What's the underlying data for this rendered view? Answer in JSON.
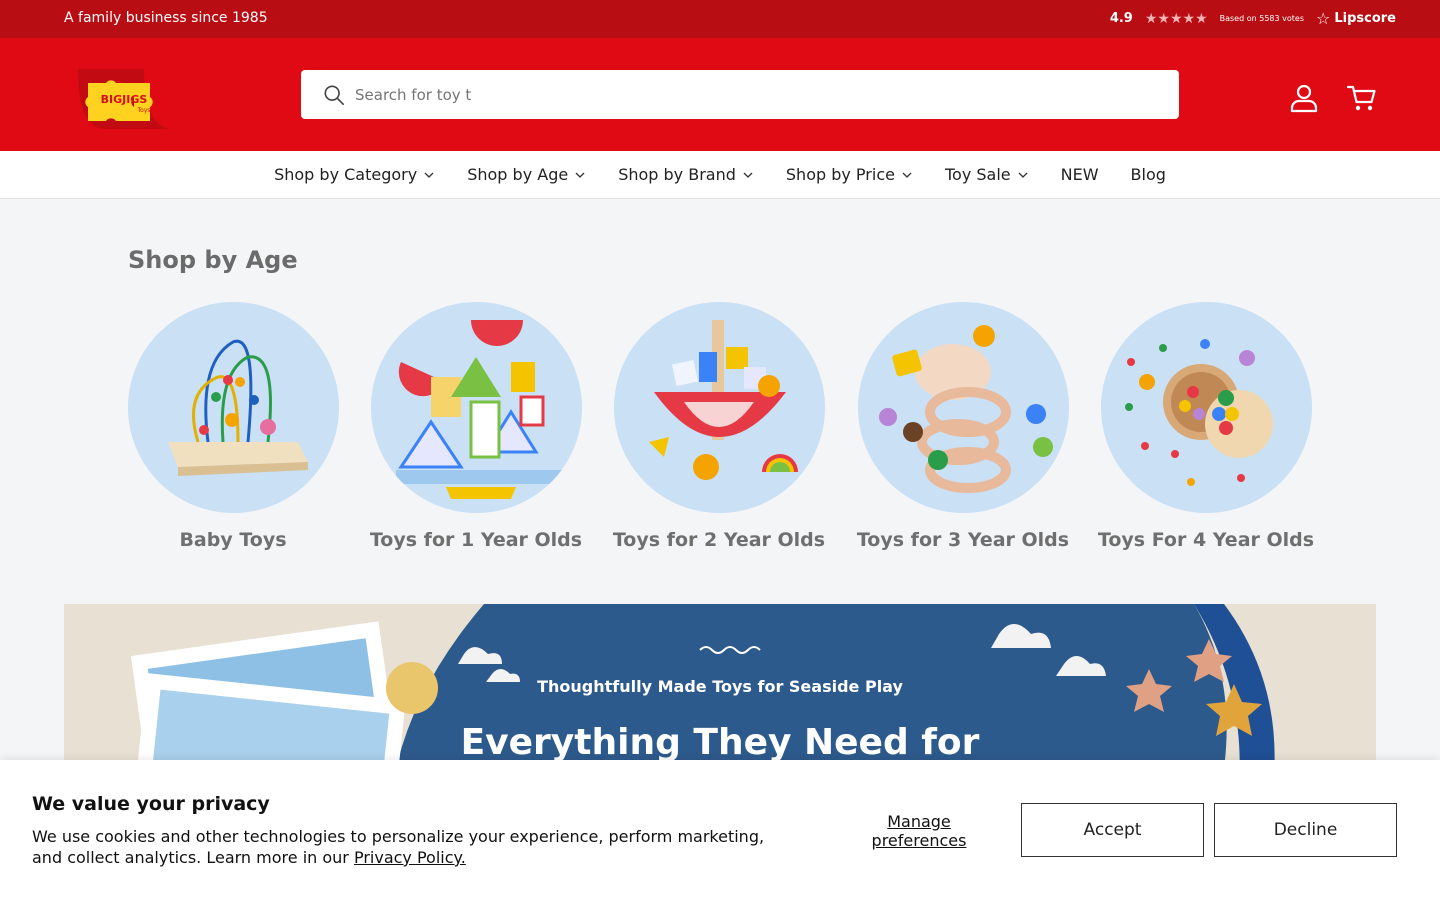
{
  "announcement": {
    "tagline": "A family business since 1985",
    "rating_score": "4.9",
    "rating_stars": "★★★★★",
    "rating_votes": "Based on 5583 votes",
    "rating_brand": "Lipscore"
  },
  "header": {
    "logo_text": "BIGJIGS",
    "logo_subtext": "Toys",
    "search_placeholder": "Search for toy t",
    "account_icon": "user-icon",
    "cart_icon": "cart-icon"
  },
  "nav": {
    "items": [
      {
        "label": "Shop by Category",
        "has_dropdown": true
      },
      {
        "label": "Shop by Age",
        "has_dropdown": true
      },
      {
        "label": "Shop by Brand",
        "has_dropdown": true
      },
      {
        "label": "Shop by Price",
        "has_dropdown": true
      },
      {
        "label": "Toy Sale",
        "has_dropdown": true
      },
      {
        "label": "NEW",
        "has_dropdown": false
      },
      {
        "label": "Blog",
        "has_dropdown": false
      }
    ]
  },
  "shop_by_age": {
    "title": "Shop by Age",
    "items": [
      {
        "label": "Baby Toys"
      },
      {
        "label": "Toys for 1 Year Olds"
      },
      {
        "label": "Toys for 2 Year Olds"
      },
      {
        "label": "Toys for 3 Year Olds"
      },
      {
        "label": "Toys For 4 Year Olds"
      }
    ]
  },
  "banner": {
    "eyebrow": "Thoughtfully Made Toys for Seaside Play",
    "headline": "Everything They Need for"
  },
  "cookie": {
    "title": "We value your privacy",
    "body": "We use cookies and other technologies to personalize your experience, perform marketing, and collect analytics. Learn more in our ",
    "link": "Privacy Policy.",
    "manage": "Manage preferences",
    "accept": "Accept",
    "decline": "Decline"
  },
  "colors": {
    "announcement_bg": "#b80d12",
    "header_bg": "#df0a14",
    "banner_blue": "#2d5a8c",
    "circle_bg": "#c9e0f5"
  }
}
